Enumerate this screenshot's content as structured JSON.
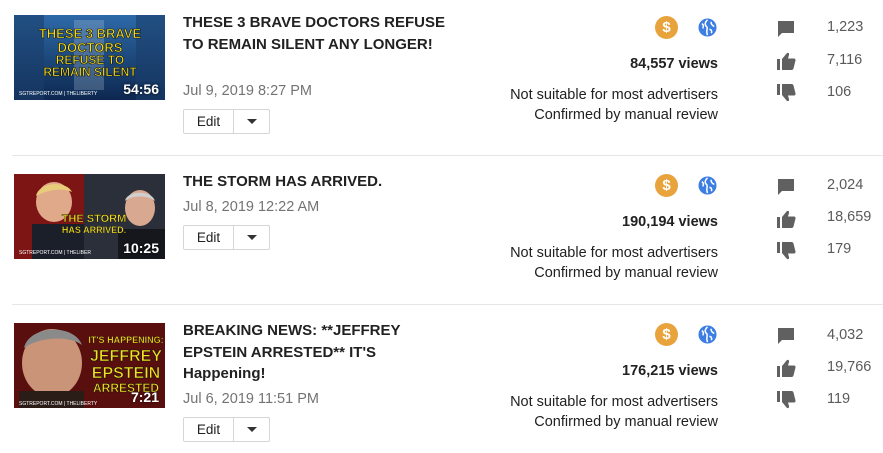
{
  "videos": [
    {
      "thumbnail": {
        "caption": "THESE 3 BRAVE DOCTORS REFUSE TO REMAIN SILENT",
        "footer": "SGTREPORT.COM | THELIBERTY",
        "duration": "54:56"
      },
      "title": "THESE 3 BRAVE DOCTORS REFUSE TO REMAIN SILENT ANY LONGER!",
      "date": "Jul 9, 2019 8:27 PM",
      "edit_label": "Edit",
      "views": "84,557 views",
      "monetization_status": "Not suitable for most advertisers",
      "review_status": "Confirmed by manual review",
      "comments": "1,223",
      "likes": "7,116",
      "dislikes": "106"
    },
    {
      "thumbnail": {
        "caption": "THE STORM HAS ARRIVED",
        "footer": "SGTREPORT.COM | THELIBER",
        "duration": "10:25"
      },
      "title": "THE STORM HAS ARRIVED.",
      "date": "Jul 8, 2019 12:22 AM",
      "edit_label": "Edit",
      "views": "190,194 views",
      "monetization_status": "Not suitable for most advertisers",
      "review_status": "Confirmed by manual review",
      "comments": "2,024",
      "likes": "18,659",
      "dislikes": "179"
    },
    {
      "thumbnail": {
        "caption_top": "IT'S HAPPENING:",
        "caption": "JEFFREY EPSTEIN ARRESTED",
        "footer": "SGTREPORT.COM | THELIBERTY",
        "duration": "7:21"
      },
      "title": "BREAKING NEWS: **JEFFREY EPSTEIN ARRESTED** IT'S Happening!",
      "date": "Jul 6, 2019 11:51 PM",
      "edit_label": "Edit",
      "views": "176,215 views",
      "monetization_status": "Not suitable for most advertisers",
      "review_status": "Confirmed by manual review",
      "comments": "4,032",
      "likes": "19,766",
      "dislikes": "119"
    }
  ],
  "icons": {
    "monetization": "dollar-icon",
    "visibility": "globe-icon",
    "comments": "comment-icon",
    "likes": "thumbs-up-icon",
    "dislikes": "thumbs-down-icon"
  },
  "colors": {
    "monetization_badge": "#e8a33d",
    "globe": "#3d7ee3",
    "stat_icon": "#606060",
    "thumb_text_yellow": "#f7e11e"
  }
}
